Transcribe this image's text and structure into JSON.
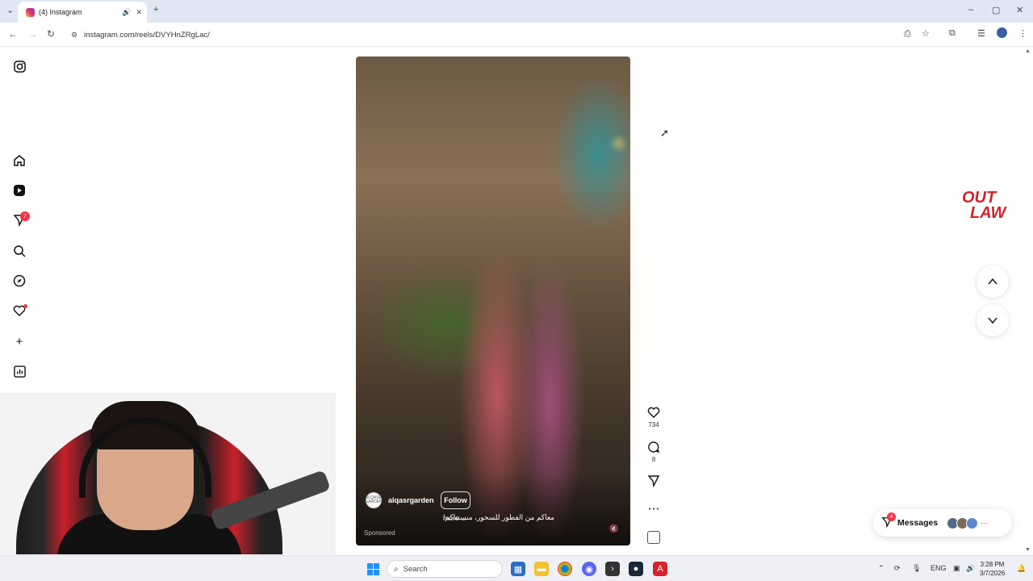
{
  "browser": {
    "tab_title": "(4) Instagram",
    "tab_audio_icon": "speaker-icon",
    "url": "instagram.com/reels/DVYHnZRgLac/",
    "window_controls": [
      "–",
      "▢",
      "✕"
    ]
  },
  "sidebar": {
    "notification_count": "7",
    "items": [
      "instagram-logo",
      "home",
      "reels",
      "direct",
      "search",
      "explore",
      "notifications",
      "create",
      "dashboard",
      "profile"
    ]
  },
  "reel": {
    "username": "alqasrgarden",
    "avatar_text": "ALQASR GARDEN",
    "follow_label": "Follow",
    "caption": "معاكم من الفطور للسحور، منستناكم!",
    "more_label": "more ...",
    "sponsored_label": "Sponsored",
    "likes": "734",
    "comments": "8"
  },
  "overlay_logo": {
    "line1": "OUT",
    "line2": "LAW",
    "color": "#d4232b"
  },
  "messages": {
    "label": "Messages",
    "badge": "4",
    "more": "···"
  },
  "taskbar": {
    "search_placeholder": "Search",
    "language": "ENG",
    "time": "3:28 PM",
    "date": "3/7/2026"
  }
}
